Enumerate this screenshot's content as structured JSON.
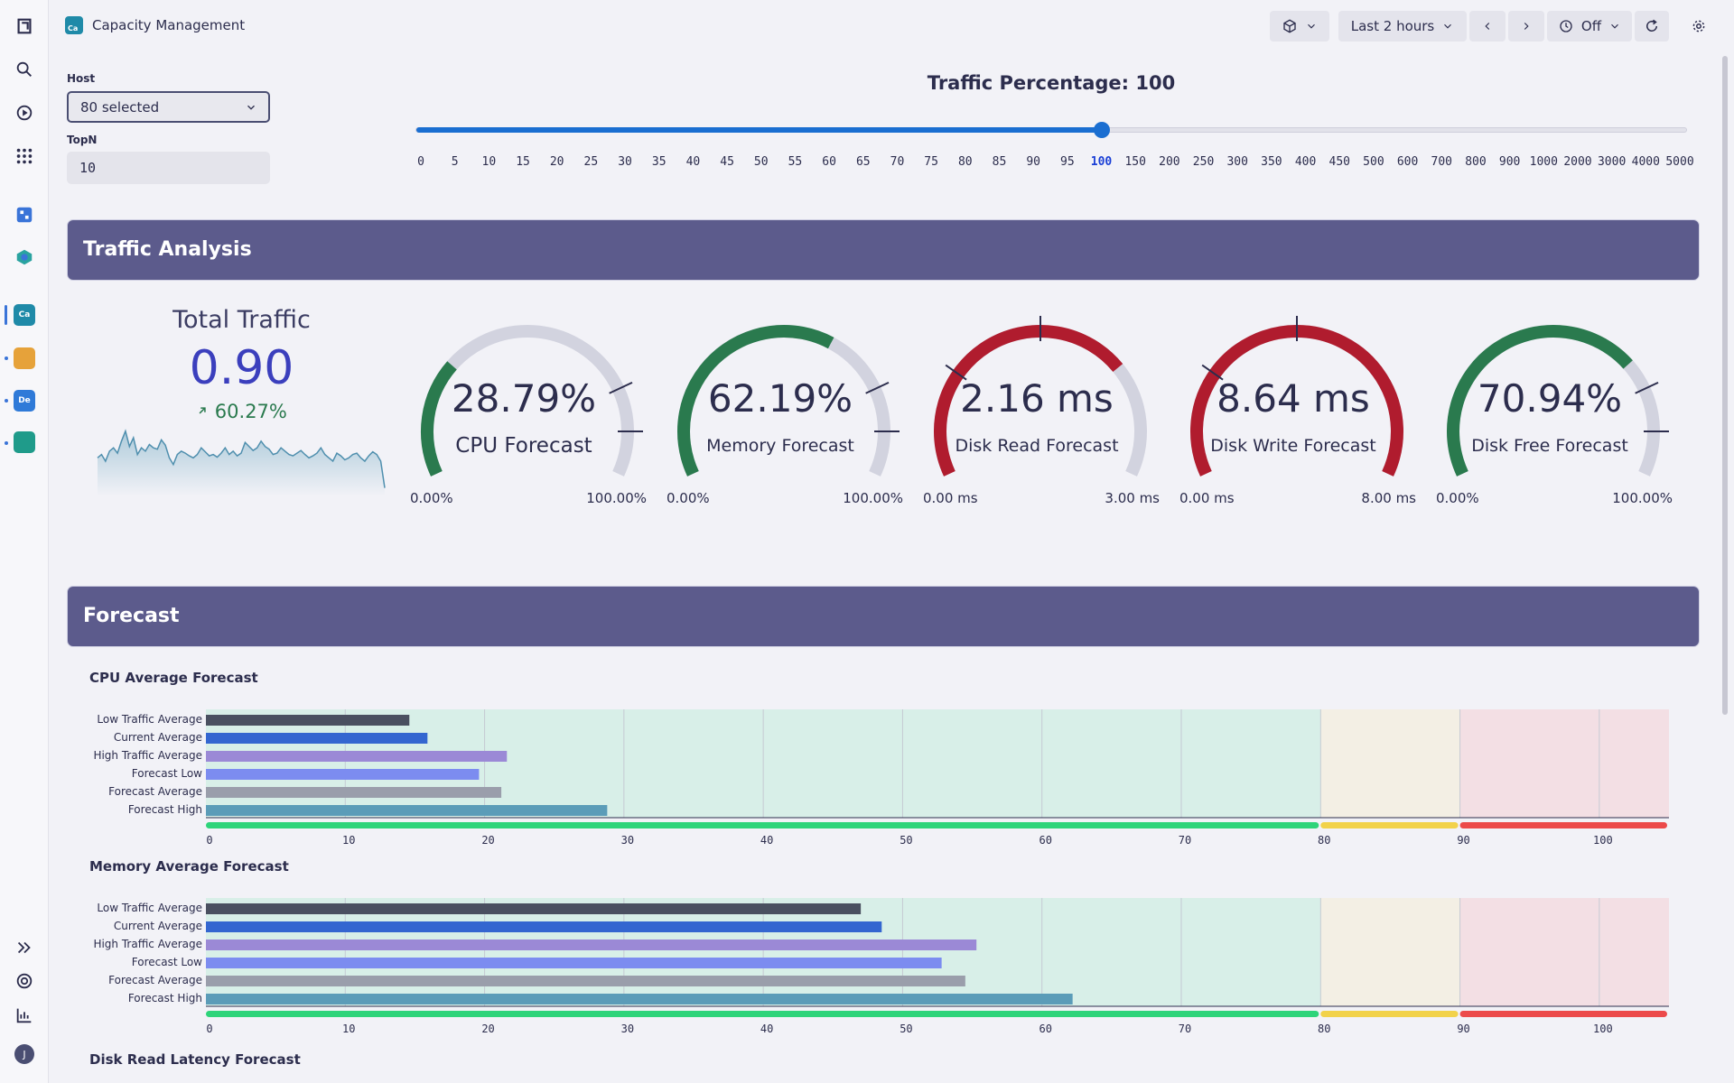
{
  "app": {
    "title": "Capacity Management",
    "badge": "Ca"
  },
  "rail": {
    "apps": [
      {
        "name": "ca",
        "label": "Ca",
        "color": "#1f8aa8"
      },
      {
        "name": "sync",
        "label": "",
        "color": "#e6a23a"
      },
      {
        "name": "de",
        "label": "De",
        "color": "#2f7ad8"
      },
      {
        "name": "report",
        "label": "",
        "color": "#1f9b8a"
      }
    ],
    "user_initial": "J"
  },
  "topbar": {
    "timeframe": "Last 2 hours",
    "refresh": "Off"
  },
  "filters": {
    "host_label": "Host",
    "host_value": "80 selected",
    "topn_label": "TopN",
    "topn_value": "10"
  },
  "slider": {
    "title": "Traffic Percentage: 100",
    "selected": "100",
    "ticks": [
      "0",
      "5",
      "10",
      "15",
      "20",
      "25",
      "30",
      "35",
      "40",
      "45",
      "50",
      "55",
      "60",
      "65",
      "70",
      "75",
      "80",
      "85",
      "90",
      "95",
      "100",
      "150",
      "200",
      "250",
      "300",
      "350",
      "400",
      "450",
      "500",
      "600",
      "700",
      "800",
      "900",
      "1000",
      "2000",
      "3000",
      "4000",
      "5000"
    ]
  },
  "sections": {
    "traffic": "Traffic Analysis",
    "forecast": "Forecast"
  },
  "kpi": {
    "title": "Total Traffic",
    "value": "0.90",
    "delta_icon": "arrow-up-right-icon",
    "delta": "60.27%",
    "sparkline": [
      0.55,
      0.6,
      0.5,
      0.65,
      0.7,
      0.62,
      0.8,
      0.95,
      0.72,
      0.85,
      0.6,
      0.7,
      0.65,
      0.75,
      0.7,
      0.68,
      0.82,
      0.74,
      0.55,
      0.45,
      0.6,
      0.65,
      0.62,
      0.58,
      0.55,
      0.6,
      0.7,
      0.64,
      0.58,
      0.6,
      0.56,
      0.62,
      0.7,
      0.6,
      0.65,
      0.58,
      0.62,
      0.78,
      0.72,
      0.66,
      0.7,
      0.8,
      0.72,
      0.68,
      0.6,
      0.62,
      0.7,
      0.65,
      0.6,
      0.58,
      0.62,
      0.66,
      0.6,
      0.55,
      0.58,
      0.62,
      0.7,
      0.6,
      0.55,
      0.5,
      0.62,
      0.58,
      0.52,
      0.55,
      0.6,
      0.62,
      0.55,
      0.5,
      0.58,
      0.64,
      0.6,
      0.5,
      0.1
    ]
  },
  "gauges": [
    {
      "name": "cpu",
      "value": "28.79%",
      "label": "CPU Forecast",
      "min": "0.00%",
      "max": "100.00%",
      "fraction": 0.2879,
      "color": "#2a7a4e",
      "big": true
    },
    {
      "name": "memory",
      "value": "62.19%",
      "label": "Memory Forecast",
      "min": "0.00%",
      "max": "100.00%",
      "fraction": 0.6219,
      "color": "#2a7a4e",
      "big": false
    },
    {
      "name": "disk-read",
      "value": "2.16 ms",
      "label": "Disk Read Forecast",
      "min": "0.00 ms",
      "max": "3.00 ms",
      "fraction": 0.72,
      "color": "#b01c2e",
      "big": false
    },
    {
      "name": "disk-write",
      "value": "8.64 ms",
      "label": "Disk Write Forecast",
      "min": "0.00 ms",
      "max": "8.00 ms",
      "fraction": 1.0,
      "color": "#b01c2e",
      "big": false
    },
    {
      "name": "disk-free",
      "value": "70.94%",
      "label": "Disk Free Forecast",
      "min": "0.00%",
      "max": "100.00%",
      "fraction": 0.7094,
      "color": "#2a7a4e",
      "big": false
    }
  ],
  "chart_data": [
    {
      "type": "bar",
      "title": "CPU Average Forecast",
      "categories": [
        "Low Traffic Average",
        "Current Average",
        "High Traffic Average",
        "Forecast Low",
        "Forecast Average",
        "Forecast High"
      ],
      "values": [
        14.6,
        15.9,
        21.6,
        19.6,
        21.2,
        28.8
      ],
      "colors": [
        "#4a5060",
        "#3466d0",
        "#9b89d6",
        "#7c8cf0",
        "#9a9eab",
        "#5b9cb8"
      ],
      "xlim": [
        0,
        105
      ],
      "xticks": [
        0,
        10,
        20,
        30,
        40,
        50,
        60,
        70,
        80,
        90,
        100
      ],
      "bands": [
        {
          "from": 0,
          "to": 80,
          "bg": "#d8efe8",
          "bar": "#2ed47a"
        },
        {
          "from": 80,
          "to": 90,
          "bg": "#f3efe4",
          "bar": "#f2d24a"
        },
        {
          "from": 90,
          "to": 105,
          "bg": "#f3dfe4",
          "bar": "#ec4a4a"
        }
      ]
    },
    {
      "type": "bar",
      "title": "Memory Average Forecast",
      "categories": [
        "Low Traffic Average",
        "Current Average",
        "High Traffic Average",
        "Forecast Low",
        "Forecast Average",
        "Forecast High"
      ],
      "values": [
        47.0,
        48.5,
        55.3,
        52.8,
        54.5,
        62.2
      ],
      "colors": [
        "#4a5060",
        "#3466d0",
        "#9b89d6",
        "#7c8cf0",
        "#9a9eab",
        "#5b9cb8"
      ],
      "xlim": [
        0,
        105
      ],
      "xticks": [
        0,
        10,
        20,
        30,
        40,
        50,
        60,
        70,
        80,
        90,
        100
      ],
      "bands": [
        {
          "from": 0,
          "to": 80,
          "bg": "#d8efe8",
          "bar": "#2ed47a"
        },
        {
          "from": 80,
          "to": 90,
          "bg": "#f3efe4",
          "bar": "#f2d24a"
        },
        {
          "from": 90,
          "to": 105,
          "bg": "#f3dfe4",
          "bar": "#ec4a4a"
        }
      ]
    }
  ],
  "next_chart_title": "Disk Read Latency Forecast"
}
